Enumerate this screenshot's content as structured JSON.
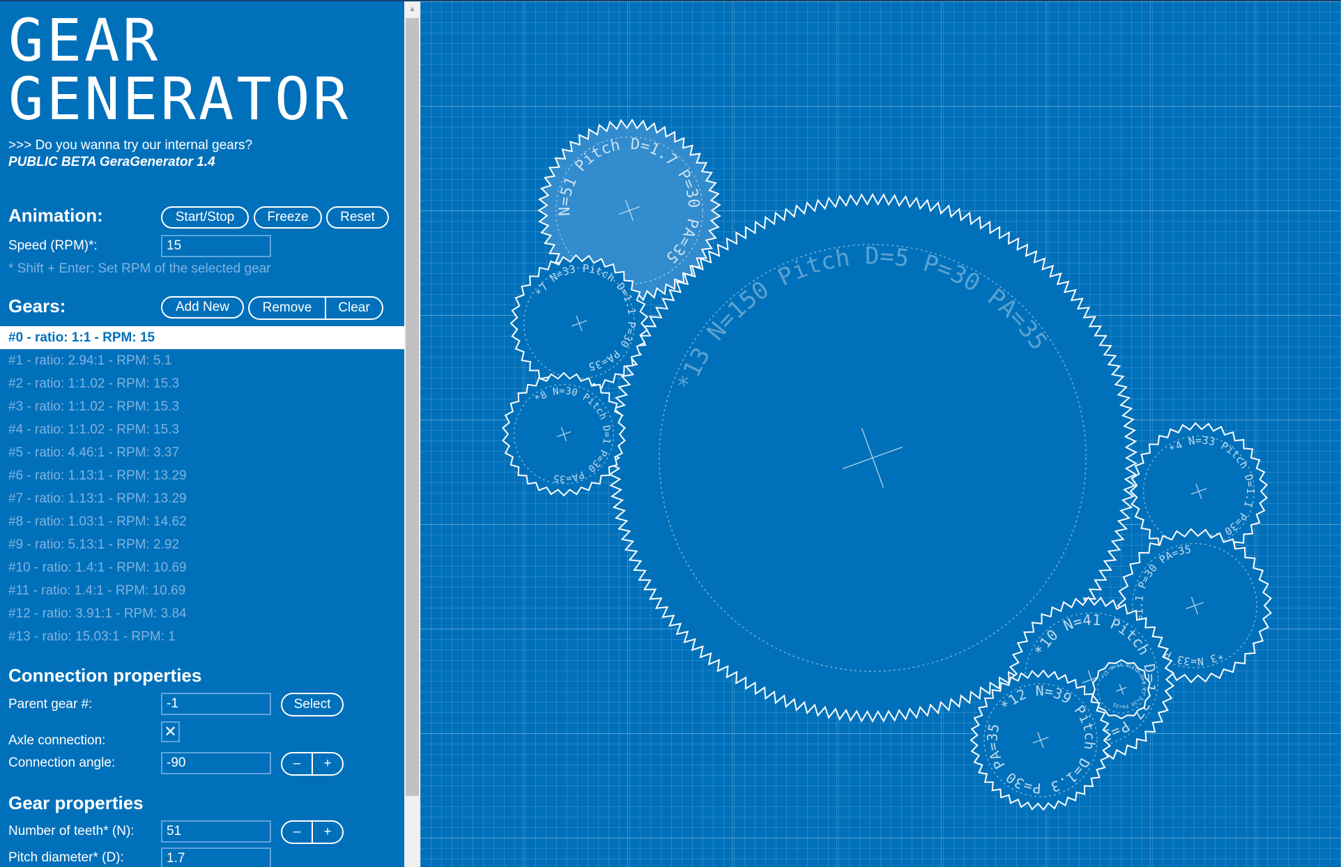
{
  "app": {
    "title_line1": "GEAR",
    "title_line2": "GENERATOR",
    "promo_link": ">>> Do you wanna try our internal gears?",
    "beta_label": "PUBLIC BETA GeraGenerator 1.4"
  },
  "animation": {
    "heading": "Animation:",
    "start_stop": "Start/Stop",
    "freeze": "Freeze",
    "reset": "Reset",
    "speed_label": "Speed (RPM)*:",
    "speed_value": "15",
    "hint": "* Shift + Enter: Set RPM of the selected gear"
  },
  "gears": {
    "heading": "Gears:",
    "add_new": "Add New",
    "remove": "Remove",
    "clear": "Clear",
    "selected_index": 0,
    "items": [
      {
        "label": "#0 - ratio: 1:1 - RPM: 15"
      },
      {
        "label": "#1 - ratio: 2.94:1 - RPM: 5.1"
      },
      {
        "label": "#2 - ratio: 1:1.02 - RPM: 15.3"
      },
      {
        "label": "#3 - ratio: 1:1.02 - RPM: 15.3"
      },
      {
        "label": "#4 - ratio: 1:1.02 - RPM: 15.3"
      },
      {
        "label": "#5 - ratio: 4.46:1 - RPM: 3.37"
      },
      {
        "label": "#6 - ratio: 1.13:1 - RPM: 13.29"
      },
      {
        "label": "#7 - ratio: 1.13:1 - RPM: 13.29"
      },
      {
        "label": "#8 - ratio: 1.03:1 - RPM: 14.62"
      },
      {
        "label": "#9 - ratio: 5.13:1 - RPM: 2.92"
      },
      {
        "label": "#10 - ratio: 1.4:1 - RPM: 10.69"
      },
      {
        "label": "#11 - ratio: 1.4:1 - RPM: 10.69"
      },
      {
        "label": "#12 - ratio: 3.91:1 - RPM: 3.84"
      },
      {
        "label": "#13 - ratio: 15.03:1 - RPM: 1"
      }
    ]
  },
  "connection": {
    "heading": "Connection properties",
    "parent_label": "Parent gear #:",
    "parent_value": "-1",
    "select": "Select",
    "axle_label": "Axle connection:",
    "axle_checked_glyph": "✕",
    "angle_label": "Connection angle:",
    "angle_value": "-90",
    "minus": "–",
    "plus": "+"
  },
  "gear_props": {
    "heading": "Gear properties",
    "teeth_label": "Number of teeth* (N):",
    "teeth_value": "51",
    "pitch_label": "Pitch diameter* (D):",
    "pitch_value": "1.7",
    "minus": "–",
    "plus": "+"
  },
  "colors": {
    "background": "#0070ba",
    "line": "#ffffff",
    "muted_text": "#7fb3e0",
    "selected_fill": "#3a8fd0"
  },
  "canvas_gears": [
    {
      "id": "0",
      "teeth": 51,
      "label": "N=51 Pitch D=1.7 P=30 PA=35",
      "selected": true
    },
    {
      "id": "1",
      "teeth": 150,
      "label": "*13 N=150 Pitch D=5 P=30 PA=35",
      "selected": false
    },
    {
      "id": "7",
      "teeth": 33,
      "label": "*7 N=33 Pitch D=1.1 P=30 PA=35",
      "selected": false
    },
    {
      "id": "8",
      "teeth": 30,
      "label": "*8 N=30 Pitch D=1 P=30 PA=35",
      "selected": false
    },
    {
      "id": "4",
      "teeth": 33,
      "label": "*4 N=33 Pitch D=1.1 P=30 PA=35",
      "selected": false
    },
    {
      "id": "3",
      "teeth": 33,
      "label": "*3 N=33 Pitch D=1.1 P=30 PA=35",
      "selected": false
    },
    {
      "id": "10",
      "teeth": 41,
      "label": "*10 N=41 Pitch D=1.37 P=30 PA=35",
      "selected": false
    },
    {
      "id": "11",
      "teeth": 14,
      "label": "*11 N=14 Pitch D=0.47 P=30 PA=35",
      "selected": false
    },
    {
      "id": "12",
      "teeth": 39,
      "label": "*12 N=39 Pitch D=1.3 P=30 PA=35",
      "selected": false
    }
  ]
}
